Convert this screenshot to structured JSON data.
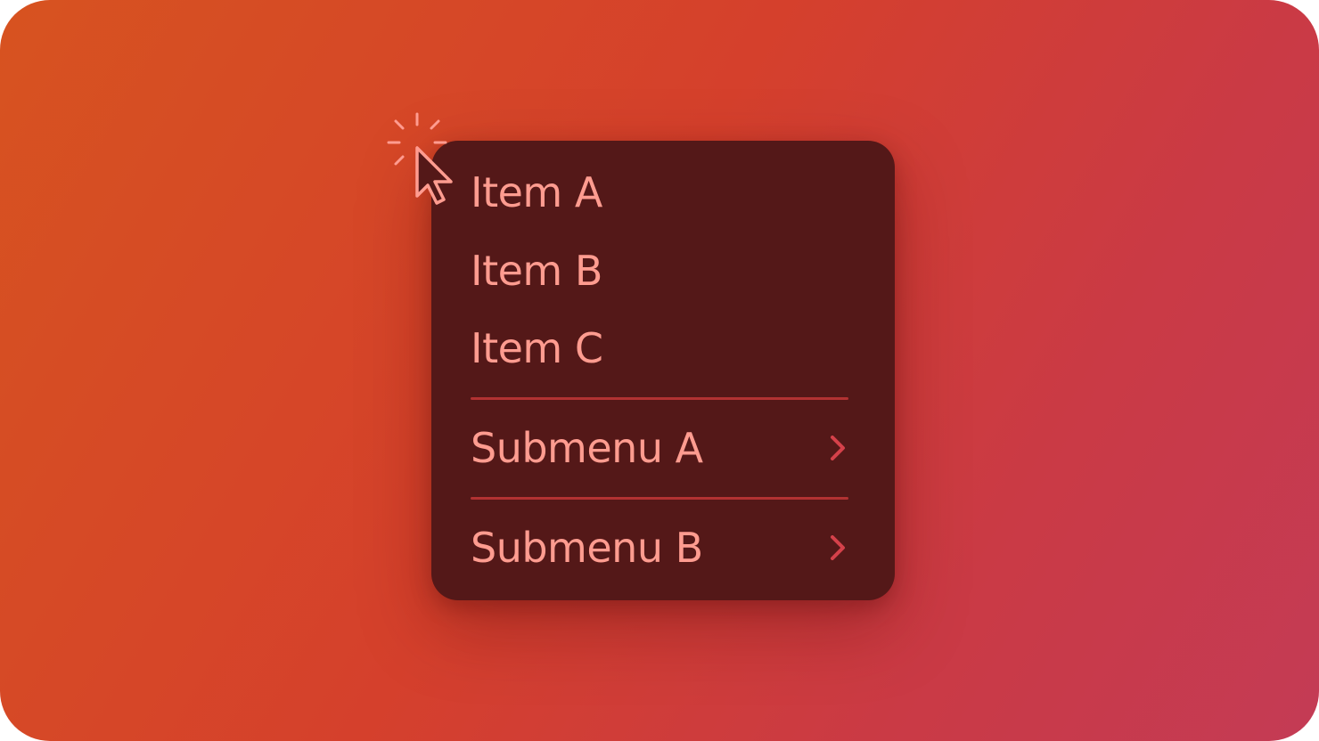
{
  "background": {
    "gradient_start": "#d75320",
    "gradient_mid": "#d5402c",
    "gradient_end": "#c43b55"
  },
  "menu": {
    "background_color": "#541818",
    "text_color": "#ff9c90",
    "separator_color": "#b23232",
    "chevron_color": "#d5414a",
    "items": [
      {
        "label": "Item A"
      },
      {
        "label": "Item B"
      },
      {
        "label": "Item C"
      }
    ],
    "submenus": [
      {
        "label": "Submenu A",
        "icon": "chevron-right-icon"
      },
      {
        "label": "Submenu B",
        "icon": "chevron-right-icon"
      }
    ]
  },
  "cursor": {
    "icon": "click-pointer-icon",
    "color": "#ff9c90"
  }
}
